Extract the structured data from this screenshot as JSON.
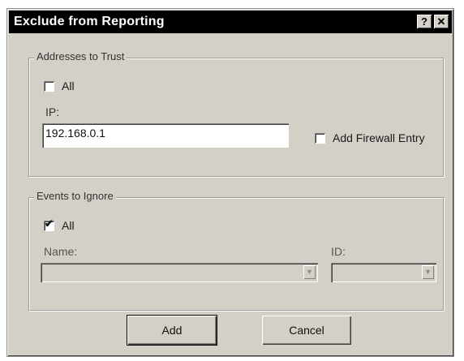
{
  "dialog": {
    "title": "Exclude from Reporting",
    "help_glyph": "?",
    "close_glyph": "✕"
  },
  "trust_group": {
    "legend": "Addresses to Trust",
    "all_label": "All",
    "all_checked": false,
    "ip_label": "IP:",
    "ip_value": "192.168.0.1",
    "firewall_label": "Add Firewall Entry",
    "firewall_checked": false
  },
  "events_group": {
    "legend": "Events to Ignore",
    "all_label": "All",
    "all_checked": true,
    "check_glyph": "✔",
    "name_label": "Name:",
    "name_value": "",
    "id_label": "ID:",
    "id_value": "",
    "arrow_glyph": "▼"
  },
  "buttons": {
    "add_label": "Add",
    "cancel_label": "Cancel"
  }
}
